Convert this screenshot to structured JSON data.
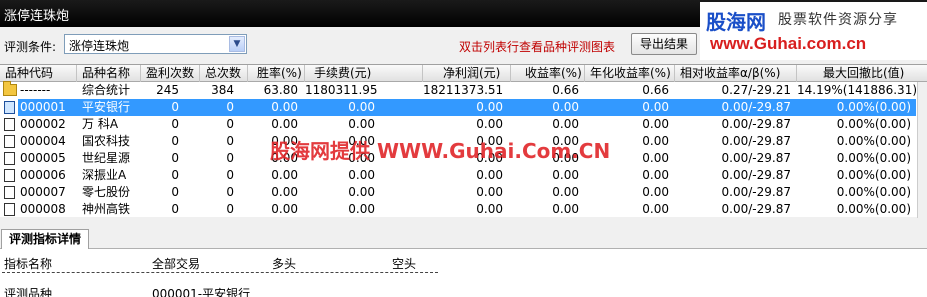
{
  "window": {
    "title": "涨停连珠炮"
  },
  "brand": {
    "logo": "股海网",
    "slogan": "股票软件资源分享",
    "url": "www.Guhai.com.cn",
    "watermark": "股海网提供 WWW.Guhai.Com.CN",
    "logo_color": "#1a4fc8",
    "url_color": "#d81e1e"
  },
  "toolbar": {
    "condition_label": "评测条件:",
    "condition_value": "涨停连珠炮",
    "hint": "双击列表行查看品种评测图表",
    "export_label": "导出结果"
  },
  "table": {
    "headers": [
      "品种代码",
      "品种名称",
      "盈利次数",
      "总次数",
      "胜率(%)",
      "手续费(元)",
      "净利润(元)",
      "收益率(%)",
      "年化收益率(%)",
      "相对收益率α/β(%)",
      "最大回撤比(值)"
    ],
    "rows": [
      {
        "icon": "folder-icon",
        "code": "-------",
        "name": "综合统计",
        "win": "245",
        "total": "384",
        "rate": "63.80",
        "fee": "1180311.95",
        "profit": "18211373.51",
        "ret": "0.66",
        "annual": "0.66",
        "relative": "0.27/-29.21",
        "drawdown": "14.19%(141886.31)"
      },
      {
        "icon": "document-icon",
        "code": "000001",
        "name": "平安银行",
        "win": "0",
        "total": "0",
        "rate": "0.00",
        "fee": "0.00",
        "profit": "0.00",
        "ret": "0.00",
        "annual": "0.00",
        "relative": "0.00/-29.87",
        "drawdown": "0.00%(0.00)",
        "selected": true
      },
      {
        "icon": "document-icon",
        "code": "000002",
        "name": "万 科A",
        "win": "0",
        "total": "0",
        "rate": "0.00",
        "fee": "0.00",
        "profit": "0.00",
        "ret": "0.00",
        "annual": "0.00",
        "relative": "0.00/-29.87",
        "drawdown": "0.00%(0.00)"
      },
      {
        "icon": "document-icon",
        "code": "000004",
        "name": "国农科技",
        "win": "0",
        "total": "0",
        "rate": "0.00",
        "fee": "0.00",
        "profit": "0.00",
        "ret": "0.00",
        "annual": "0.00",
        "relative": "0.00/-29.87",
        "drawdown": "0.00%(0.00)"
      },
      {
        "icon": "document-icon",
        "code": "000005",
        "name": "世纪星源",
        "win": "0",
        "total": "0",
        "rate": "0.00",
        "fee": "0.00",
        "profit": "0.00",
        "ret": "0.00",
        "annual": "0.00",
        "relative": "0.00/-29.87",
        "drawdown": "0.00%(0.00)"
      },
      {
        "icon": "document-icon",
        "code": "000006",
        "name": "深振业A",
        "win": "0",
        "total": "0",
        "rate": "0.00",
        "fee": "0.00",
        "profit": "0.00",
        "ret": "0.00",
        "annual": "0.00",
        "relative": "0.00/-29.87",
        "drawdown": "0.00%(0.00)"
      },
      {
        "icon": "document-icon",
        "code": "000007",
        "name": "零七股份",
        "win": "0",
        "total": "0",
        "rate": "0.00",
        "fee": "0.00",
        "profit": "0.00",
        "ret": "0.00",
        "annual": "0.00",
        "relative": "0.00/-29.87",
        "drawdown": "0.00%(0.00)"
      },
      {
        "icon": "document-icon",
        "code": "000008",
        "name": "神州高铁",
        "win": "0",
        "total": "0",
        "rate": "0.00",
        "fee": "0.00",
        "profit": "0.00",
        "ret": "0.00",
        "annual": "0.00",
        "relative": "0.00/-29.87",
        "drawdown": "0.00%(0.00)"
      }
    ],
    "selection_color": "#3399ff"
  },
  "detail": {
    "tab_label": "评测指标详情",
    "headers": [
      "指标名称",
      "全部交易",
      "多头",
      "空头"
    ],
    "row": {
      "name": "评测品种",
      "all": "000001-平安银行"
    }
  }
}
